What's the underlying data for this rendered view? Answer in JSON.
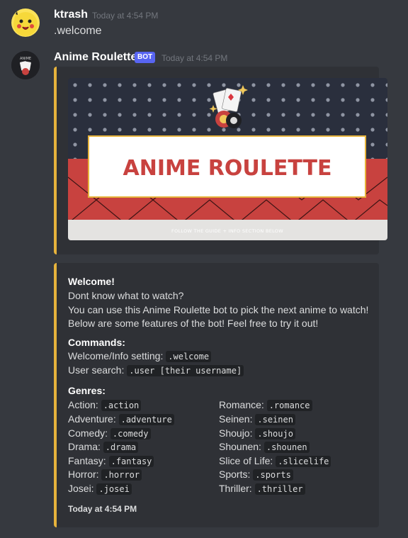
{
  "messages": [
    {
      "username": "ktrash",
      "timestamp": "Today at 4:54 PM",
      "text": ".welcome",
      "avatar": "pikachu-avatar"
    },
    {
      "username": "Anime Roulette",
      "bot_tag": "BOT",
      "timestamp": "Today at 4:54 PM",
      "avatar": "anime-roulette-avatar"
    }
  ],
  "banner": {
    "title": "ANIME ROULETTE",
    "subtitle": "FOLLOW THE GUIDE + INFO SECTION BELOW"
  },
  "embed": {
    "welcome_title": "Welcome!",
    "lines": [
      "Dont know what to watch?",
      "You can use this Anime Roulette bot to pick the next anime to watch!",
      "Below are some features of the bot! Feel free to try it out!"
    ],
    "commands_title": "Commands:",
    "commands": [
      {
        "label": "Welcome/Info setting:",
        "code": ".welcome"
      },
      {
        "label": "User search:",
        "code": ".user [their username]"
      }
    ],
    "genres_title": "Genres:",
    "genres_left": [
      {
        "label": "Action:",
        "code": ".action"
      },
      {
        "label": "Adventure:",
        "code": ".adventure"
      },
      {
        "label": "Comedy:",
        "code": ".comedy"
      },
      {
        "label": "Drama:",
        "code": ".drama"
      },
      {
        "label": "Fantasy:",
        "code": ".fantasy"
      },
      {
        "label": "Horror:",
        "code": ".horror"
      },
      {
        "label": "Josei:",
        "code": ".josei"
      }
    ],
    "genres_right": [
      {
        "label": "Romance:",
        "code": ".romance"
      },
      {
        "label": "Seinen:",
        "code": ".seinen"
      },
      {
        "label": "Shoujo:",
        "code": ".shoujo"
      },
      {
        "label": "Shounen:",
        "code": ".shounen"
      },
      {
        "label": "Slice of Life:",
        "code": ".slicelife"
      },
      {
        "label": "Sports:",
        "code": ".sports"
      },
      {
        "label": "Thriller:",
        "code": ".thriller"
      }
    ],
    "footer": "Today at 4:54 PM"
  },
  "colors": {
    "accent": "#e6b33c",
    "background": "#36393f",
    "embed_bg": "#2f3136",
    "banner_red": "#c8423f",
    "banner_navy": "#2a2f3d"
  }
}
